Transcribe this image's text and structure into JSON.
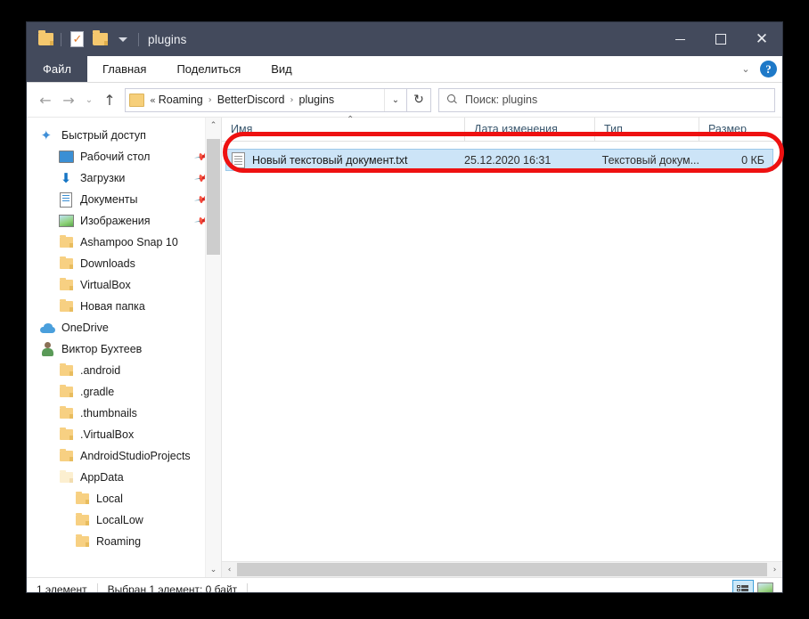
{
  "window": {
    "title": "plugins",
    "quick_access": [
      {
        "name": "folder-icon",
        "label": "plugins"
      },
      {
        "name": "properties-icon",
        "label": "Свойства"
      },
      {
        "name": "new-folder-icon",
        "label": "Создать папку"
      },
      {
        "name": "customize-caret-icon",
        "label": "Настроить панель быстрого доступа"
      }
    ],
    "controls": {
      "minimize": "—",
      "maximize": "□",
      "close": "✕"
    }
  },
  "ribbon": {
    "tabs": [
      {
        "label": "Файл",
        "active": true
      },
      {
        "label": "Главная",
        "active": false
      },
      {
        "label": "Поделиться",
        "active": false
      },
      {
        "label": "Вид",
        "active": false
      }
    ],
    "expand_caret": "⌄",
    "help_label": "?"
  },
  "address": {
    "back": "←",
    "forward": "→",
    "recent": "⌄",
    "up": "↑",
    "lead": "«",
    "crumbs": [
      "Roaming",
      "BetterDiscord",
      "plugins"
    ],
    "separator": "›",
    "dropdown": "⌄",
    "refresh": "↻"
  },
  "search": {
    "placeholder": "Поиск: plugins",
    "value": "Поиск: plugins"
  },
  "sidebar": {
    "items": [
      {
        "label": "Быстрый доступ",
        "icon": "star-icon",
        "level": 0,
        "pinned": false
      },
      {
        "label": "Рабочий стол",
        "icon": "desktop-icon",
        "level": 1,
        "pinned": true
      },
      {
        "label": "Загрузки",
        "icon": "download-icon",
        "level": 1,
        "pinned": true
      },
      {
        "label": "Документы",
        "icon": "documents-icon",
        "level": 1,
        "pinned": true
      },
      {
        "label": "Изображения",
        "icon": "pictures-icon",
        "level": 1,
        "pinned": true
      },
      {
        "label": "Ashampoo Snap 10",
        "icon": "folder-icon",
        "level": 1,
        "pinned": false
      },
      {
        "label": "Downloads",
        "icon": "folder-icon",
        "level": 1,
        "pinned": false
      },
      {
        "label": "VirtualBox",
        "icon": "folder-icon",
        "level": 1,
        "pinned": false
      },
      {
        "label": "Новая папка",
        "icon": "folder-icon",
        "level": 1,
        "pinned": false
      },
      {
        "label": "OneDrive",
        "icon": "cloud-icon",
        "level": 0,
        "pinned": false
      },
      {
        "label": "Виктор Бухтеев",
        "icon": "user-icon",
        "level": 0,
        "pinned": false
      },
      {
        "label": ".android",
        "icon": "folder-icon",
        "level": 1,
        "pinned": false
      },
      {
        "label": ".gradle",
        "icon": "folder-icon",
        "level": 1,
        "pinned": false
      },
      {
        "label": ".thumbnails",
        "icon": "folder-icon",
        "level": 1,
        "pinned": false
      },
      {
        "label": ".VirtualBox",
        "icon": "folder-icon",
        "level": 1,
        "pinned": false
      },
      {
        "label": "AndroidStudioProjects",
        "icon": "folder-icon",
        "level": 1,
        "pinned": false
      },
      {
        "label": "AppData",
        "icon": "folder-pale-icon",
        "level": 1,
        "pinned": false
      },
      {
        "label": "Local",
        "icon": "folder-icon",
        "level": 2,
        "pinned": false
      },
      {
        "label": "LocalLow",
        "icon": "folder-icon",
        "level": 2,
        "pinned": false
      },
      {
        "label": "Roaming",
        "icon": "folder-icon",
        "level": 2,
        "pinned": false
      }
    ],
    "scroll_up": "⌃",
    "scroll_down": "⌄"
  },
  "columns": {
    "name": "Имя",
    "date": "Дата изменения",
    "type": "Тип",
    "size": "Размер",
    "sort_indicator": "⌃"
  },
  "files": [
    {
      "name": "Новый текстовый документ.txt",
      "date": "25.12.2020 16:31",
      "type": "Текстовый докум...",
      "size": "0 КБ",
      "icon": "text-file-icon",
      "selected": true
    }
  ],
  "hscroll": {
    "left": "‹",
    "right": "›"
  },
  "status": {
    "count": "1 элемент",
    "selection": "Выбран 1 элемент: 0 байт"
  },
  "view_buttons": [
    {
      "name": "details-view-button",
      "label": "Таблица",
      "active": true
    },
    {
      "name": "thumbnails-view-button",
      "label": "Крупные значки",
      "active": false
    }
  ],
  "annotation": {
    "color": "#ee1111",
    "target": "Новый текстовый документ.txt"
  }
}
